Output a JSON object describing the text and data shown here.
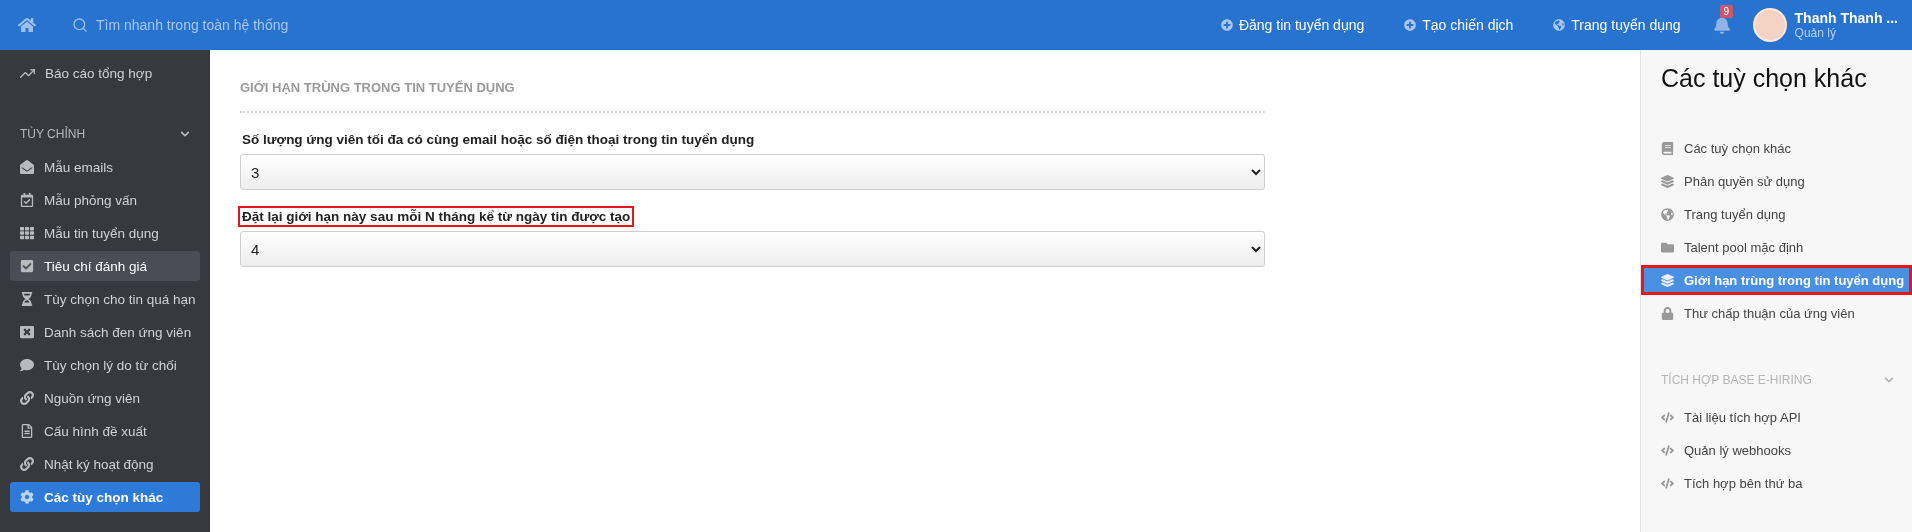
{
  "topbar": {
    "search": {
      "placeholder": "Tìm nhanh trong toàn hệ thống"
    },
    "links": [
      {
        "label": "Đăng tin tuyển dụng"
      },
      {
        "label": "Tạo chiến dịch"
      },
      {
        "label": "Trang tuyển dụng"
      }
    ],
    "notifications": {
      "count": "9"
    },
    "user": {
      "name": "Thanh Thanh ...",
      "role": "Quản lý"
    }
  },
  "sidebar": {
    "top_items": [
      {
        "label": "Báo cáo tổng hợp",
        "selected": false,
        "hovered": false
      }
    ],
    "section": {
      "title": "TÙY CHỈNH",
      "expanded": true
    },
    "items": [
      {
        "label": "Mẫu emails",
        "selected": false,
        "hovered": false
      },
      {
        "label": "Mẫu phỏng vấn",
        "selected": false,
        "hovered": false
      },
      {
        "label": "Mẫu tin tuyển dụng",
        "selected": false,
        "hovered": false
      },
      {
        "label": "Tiêu chí đánh giá",
        "selected": false,
        "hovered": true
      },
      {
        "label": "Tùy chọn cho tin quá hạn",
        "selected": false,
        "hovered": false
      },
      {
        "label": "Danh sách đen ứng viên",
        "selected": false,
        "hovered": false
      },
      {
        "label": "Tùy chọn lý do từ chối",
        "selected": false,
        "hovered": false
      },
      {
        "label": "Nguồn ứng viên",
        "selected": false,
        "hovered": false
      },
      {
        "label": "Cấu hình đề xuất",
        "selected": false,
        "hovered": false
      },
      {
        "label": "Nhật ký hoạt động",
        "selected": false,
        "hovered": false
      },
      {
        "label": "Các tùy chọn khác",
        "selected": true,
        "hovered": false
      }
    ]
  },
  "main": {
    "title": "GIỚI HẠN TRÙNG TRONG TIN TUYỂN DỤNG",
    "fields": [
      {
        "label": "Số lượng ứng viên tối đa có cùng email hoặc số điện thoại trong tin tuyển dụng",
        "value": "3",
        "outlined": false
      },
      {
        "label": "Đặt lại giới hạn này sau mỗi N tháng kể từ ngày tin được tạo",
        "value": "4",
        "outlined": true
      }
    ]
  },
  "options_panel": {
    "title": "Các tuỳ chọn khác",
    "items": [
      {
        "label": "Các tuỳ chọn khác",
        "selected": false,
        "outlined": false
      },
      {
        "label": "Phân quyền sử dụng",
        "selected": false,
        "outlined": false
      },
      {
        "label": "Trang tuyển dụng",
        "selected": false,
        "outlined": false
      },
      {
        "label": "Talent pool mặc định",
        "selected": false,
        "outlined": false
      },
      {
        "label": "Giới hạn trùng trong tin tuyển dụng",
        "selected": true,
        "outlined": true
      },
      {
        "label": "Thư chấp thuận của ứng viên",
        "selected": false,
        "outlined": false
      }
    ],
    "section": {
      "title": "TÍCH HỢP BASE E-HIRING",
      "expanded": true
    },
    "integration_items": [
      {
        "label": "Tài liệu tích hợp API",
        "selected": false,
        "outlined": false
      },
      {
        "label": "Quản lý webhooks",
        "selected": false,
        "outlined": false
      },
      {
        "label": "Tích hợp bên thứ ba",
        "selected": false,
        "outlined": false
      }
    ]
  }
}
